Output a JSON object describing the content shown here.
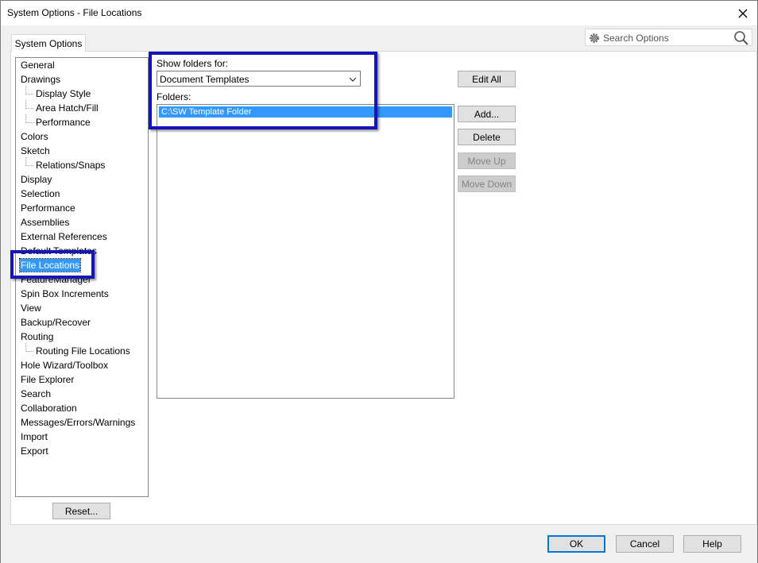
{
  "window": {
    "title": "System Options - File Locations"
  },
  "tab": {
    "label": "System Options"
  },
  "search": {
    "placeholder": "Search Options"
  },
  "tree": {
    "items": [
      {
        "label": "General",
        "level": 0
      },
      {
        "label": "Drawings",
        "level": 0
      },
      {
        "label": "Display Style",
        "level": 1
      },
      {
        "label": "Area Hatch/Fill",
        "level": 1
      },
      {
        "label": "Performance",
        "level": 1
      },
      {
        "label": "Colors",
        "level": 0
      },
      {
        "label": "Sketch",
        "level": 0
      },
      {
        "label": "Relations/Snaps",
        "level": 1
      },
      {
        "label": "Display",
        "level": 0
      },
      {
        "label": "Selection",
        "level": 0
      },
      {
        "label": "Performance",
        "level": 0
      },
      {
        "label": "Assemblies",
        "level": 0
      },
      {
        "label": "External References",
        "level": 0
      },
      {
        "label": "Default Templates",
        "level": 0
      },
      {
        "label": "File Locations",
        "level": 0,
        "selected": true
      },
      {
        "label": "FeatureManager",
        "level": 0
      },
      {
        "label": "Spin Box Increments",
        "level": 0
      },
      {
        "label": "View",
        "level": 0
      },
      {
        "label": "Backup/Recover",
        "level": 0
      },
      {
        "label": "Routing",
        "level": 0
      },
      {
        "label": "Routing File Locations",
        "level": 1
      },
      {
        "label": "Hole Wizard/Toolbox",
        "level": 0
      },
      {
        "label": "File Explorer",
        "level": 0
      },
      {
        "label": "Search",
        "level": 0
      },
      {
        "label": "Collaboration",
        "level": 0
      },
      {
        "label": "Messages/Errors/Warnings",
        "level": 0
      },
      {
        "label": "Import",
        "level": 0
      },
      {
        "label": "Export",
        "level": 0
      }
    ],
    "reset_label": "Reset..."
  },
  "main": {
    "show_folders_label": "Show folders for:",
    "show_folders_value": "Document Templates",
    "folders_label": "Folders:",
    "folders": [
      "C:\\SW Template Folder"
    ],
    "buttons": {
      "edit_all": "Edit All",
      "add": "Add...",
      "delete": "Delete",
      "move_up": "Move Up",
      "move_down": "Move Down"
    }
  },
  "footer": {
    "ok": "OK",
    "cancel": "Cancel",
    "help": "Help"
  },
  "colors": {
    "highlight_border": "#1414b8",
    "selection": "#3399ff"
  }
}
